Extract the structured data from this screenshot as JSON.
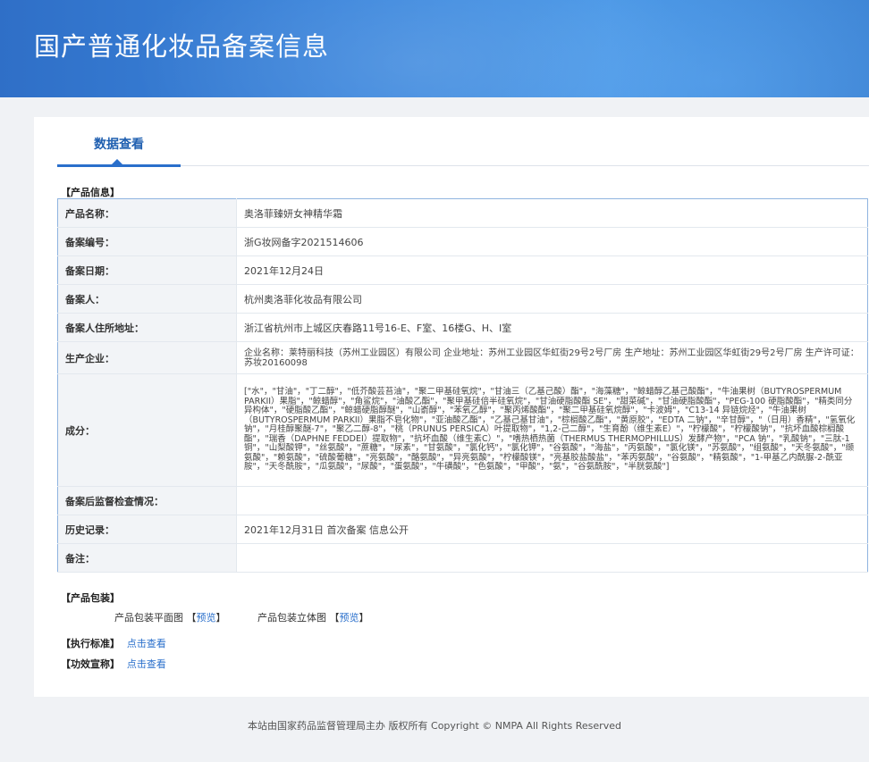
{
  "header": {
    "title": "国产普通化妆品备案信息"
  },
  "tabs": [
    {
      "label": "数据查看"
    }
  ],
  "product_info": {
    "section_title": "【产品信息】",
    "rows": [
      {
        "label": "产品名称：",
        "value": "奥洛菲臻妍女神精华霜"
      },
      {
        "label": "备案编号：",
        "value": "浙G妆网备字2021514606"
      },
      {
        "label": "备案日期：",
        "value": "2021年12月24日"
      },
      {
        "label": "备案人：",
        "value": "杭州奥洛菲化妆品有限公司"
      },
      {
        "label": "备案人住所地址：",
        "value": "浙江省杭州市上城区庆春路11号16-E、F室、16楼G、H、I室"
      },
      {
        "label": "生产企业：",
        "value": "企业名称：莱特丽科技（苏州工业园区）有限公司 企业地址：苏州工业园区华虹街29号2号厂房 生产地址：苏州工业园区华虹街29号2号厂房 生产许可证：苏妆20160098"
      },
      {
        "label": "成分：",
        "value": "[\"水\"，\"甘油\"，\"丁二醇\"，\"低芥酸芸苔油\"，\"聚二甲基硅氧烷\"，\"甘油三（乙基己酸）酯\"，\"海藻糖\"，\"鲸蜡醇乙基己酸酯\"，\"牛油果树（BUTYROSPERMUM PARKII）果脂\"，\"鲸蜡醇\"，\"角鲨烷\"，\"油酸乙酯\"，\"聚甲基硅倍半硅氧烷\"，\"甘油硬脂酸酯 SE\"，\"甜菜碱\"，\"甘油硬脂酸酯\"，\"PEG-100 硬脂酸酯\"，\"精类同分异构体\"，\"硬脂酸乙酯\"，\"鲸蜡硬脂醇醚\"，\"山嵛醇\"，\"苯氧乙醇\"，\"聚丙烯酸酯\"，\"聚二甲基硅氧烷醇\"，\"卡波姆\"，\"C13-14 异链烷烃\"，\"牛油果树（BUTYROSPERMUM PARKII）果脂不皂化物\"，\"亚油酸乙酯\"，\"乙基己基甘油\"，\"棕榈酸乙酯\"，\"黄原胶\"，\"EDTA 二钠\"，\"辛甘醇\"，\"（日用）香精\"，\"氢氧化钠\"，\"月桂醇聚醚-7\"，\"聚乙二醇-8\"，\"桃（PRUNUS PERSICA）叶提取物\"，\"1,2-己二醇\"，\"生育酚（维生素E）\"，\"柠檬酸\"，\"柠檬酸钠\"，\"抗坏血酸棕榈酸酯\"，\"瑞香（DAPHNE FEDDEI）提取物\"，\"抗坏血酸（维生素C）\"，\"嗜热栖热菌（THERMUS THERMOPHILLUS）发酵产物\"，\"PCA 钠\"，\"乳酸钠\"，\"三肽-1 铜\"，\"山梨酸钾\"，\"丝氨酸\"，\"蔗糖\"，\"尿素\"，\"甘氨酸\"，\"氯化钙\"，\"氯化钾\"，\"谷氨酸\"，\"海盐\"，\"丙氨酸\"，\"氯化镁\"，\"苏氨酸\"，\"组氨酸\"，\"天冬氨酸\"，\"缬氨酸\"，\"赖氨酸\"，\"硫酸葡糖\"，\"亮氨酸\"，\"酪氨酸\"，\"异亮氨酸\"，\"柠檬酸镁\"，\"亮基胶盐酸盐\"，\"苯丙氨酸\"，\"谷氨酸\"，\"精氨酸\"，\"1-甲基乙内酰脲-2-酰亚胺\"，\"天冬酰胺\"，\"瓜氨酸\"，\"尿酸\"，\"蛋氨酸\"，\"牛磺酸\"，\"色氨酸\"，\"甲酸\"，\"氨\"，\"谷氨酰胺\"，\"半胱氨酸\"]"
      },
      {
        "label": "备案后监督检查情况：",
        "value": ""
      },
      {
        "label": "历史记录：",
        "value": "2021年12月31日 首次备案 信息公开"
      },
      {
        "label": "备注：",
        "value": ""
      }
    ]
  },
  "packaging": {
    "section_title": "【产品包装】",
    "flat_label": "产品包装平面图",
    "flat_link": "预览",
    "solid_label": "产品包装立体图",
    "solid_link": "预览"
  },
  "standard": {
    "section_title": "【执行标准】",
    "link": "点击查看"
  },
  "efficacy": {
    "section_title": "【功效宣称】",
    "link": "点击查看"
  },
  "footer": {
    "text": "本站由国家药品监督管理局主办 版权所有 Copyright © NMPA All Rights Reserved"
  }
}
